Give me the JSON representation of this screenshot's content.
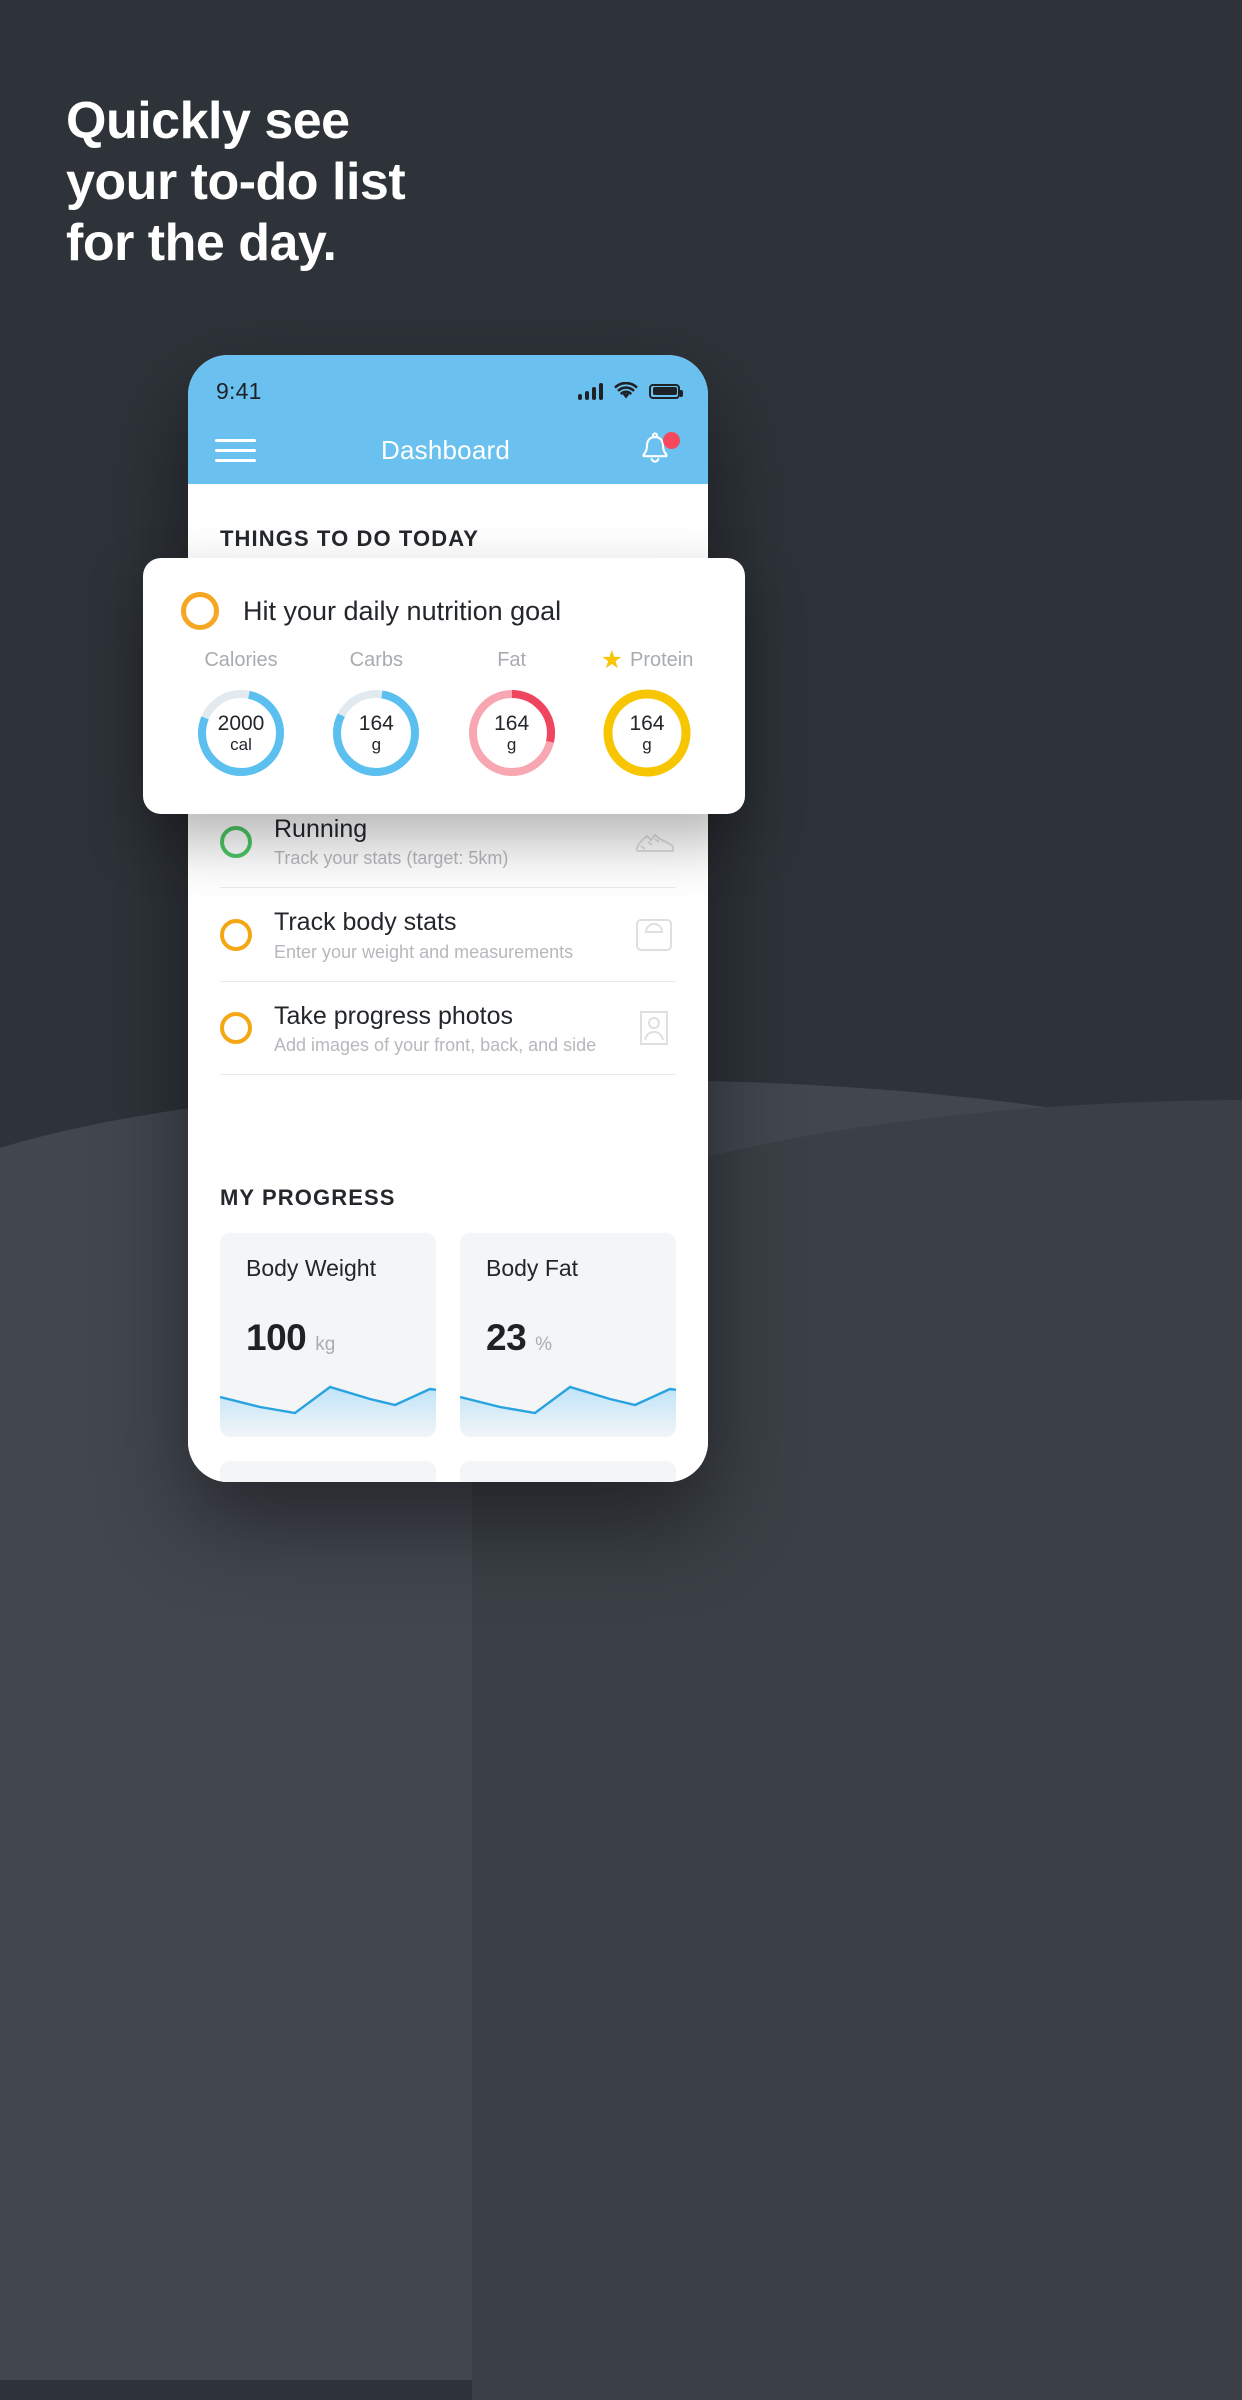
{
  "promo": {
    "headline_lines": [
      "Quickly see",
      "your to-do list",
      "for the day."
    ],
    "bg_color_top": "#2e3339",
    "bg_color_bottom": "#42474f"
  },
  "phone": {
    "status_bar": {
      "time": "9:41",
      "signal_icon": "signal-bars-icon",
      "wifi_icon": "wifi-icon",
      "battery_icon": "battery-full-icon"
    },
    "app_bar": {
      "menu_icon": "hamburger-menu-icon",
      "title": "Dashboard",
      "notification_icon": "bell-icon",
      "has_notification_dot": true,
      "bar_color": "#6ac0ee"
    },
    "sections": {
      "todo_heading": "THINGS TO DO TODAY",
      "progress_heading": "MY PROGRESS"
    },
    "todo_items": [
      {
        "title": "Running",
        "subtitle": "Track your stats (target: 5km)",
        "ring_color": "#4cc764",
        "icon": "running-shoe-icon"
      },
      {
        "title": "Track body stats",
        "subtitle": "Enter your weight and measurements",
        "ring_color": "#f3a712",
        "icon": "weight-scale-icon"
      },
      {
        "title": "Take progress photos",
        "subtitle": "Add images of your front, back, and side",
        "ring_color": "#f3a712",
        "icon": "person-photo-icon"
      }
    ],
    "progress_cards": [
      {
        "label": "Body Weight",
        "value": "100",
        "unit": "kg",
        "spark_color": "#29a3e0"
      },
      {
        "label": "Body Fat",
        "value": "23",
        "unit": "%",
        "spark_color": "#29a3e0"
      }
    ]
  },
  "nutrition_card": {
    "check_ring_color": "#f5a623",
    "title": "Hit your daily nutrition goal",
    "macros": [
      {
        "label": "Calories",
        "value": "2000",
        "unit": "cal",
        "ring_color": "#5bc0f0",
        "starred": false,
        "percent": 78
      },
      {
        "label": "Carbs",
        "value": "164",
        "unit": "g",
        "ring_color": "#5bc0f0",
        "starred": false,
        "percent": 80
      },
      {
        "label": "Fat",
        "value": "164",
        "unit": "g",
        "ring_color": "#f8798c",
        "ring_color_2": "#f0455f",
        "starred": false,
        "percent": 100
      },
      {
        "label": "Protein",
        "value": "164",
        "unit": "g",
        "ring_color": "#f7c600",
        "starred": true,
        "percent": 100
      }
    ]
  }
}
